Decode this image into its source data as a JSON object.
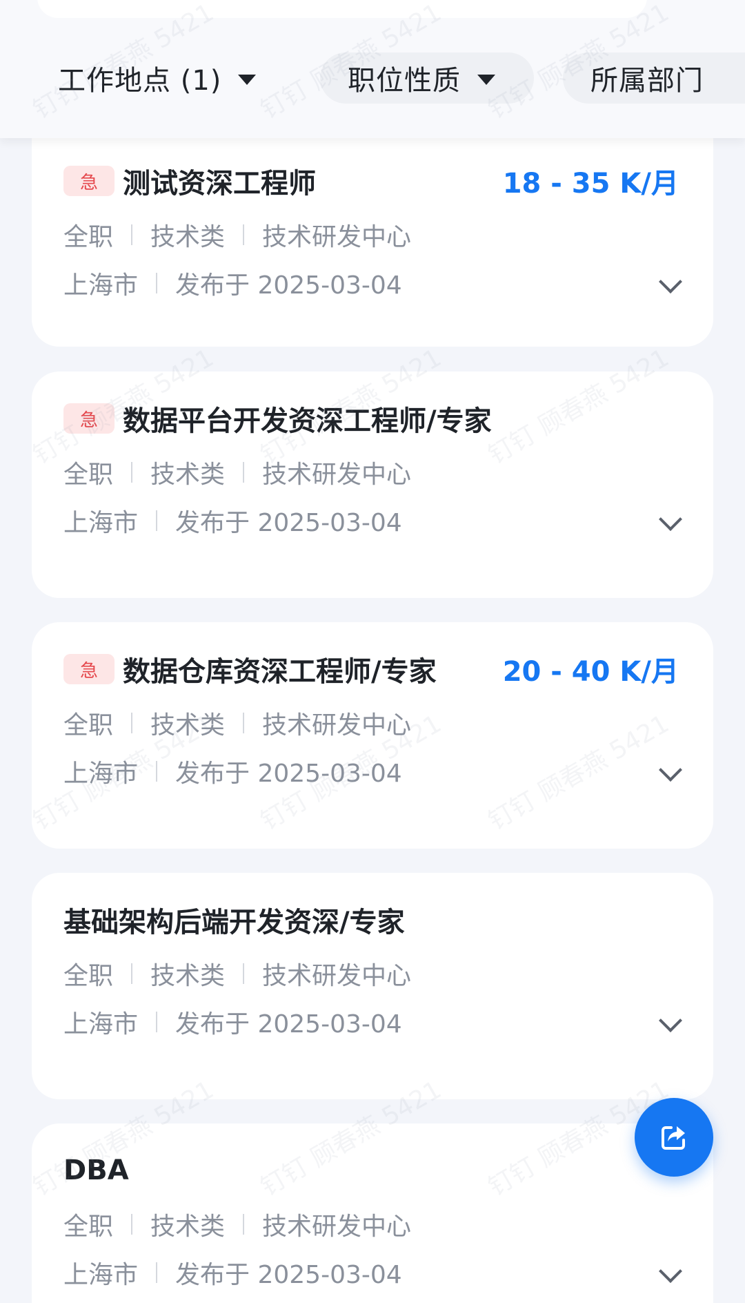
{
  "filters": [
    {
      "label": "工作地点 (1)"
    },
    {
      "label": "职位性质"
    },
    {
      "label": "所属部门"
    }
  ],
  "jobs": [
    {
      "urgent": "急",
      "title": "测试资深工程师",
      "salary": "18 - 35 K/月",
      "type": "全职",
      "category": "技术类",
      "department": "技术研发中心",
      "city": "上海市",
      "published": "发布于 2025-03-04"
    },
    {
      "urgent": "急",
      "title": "数据平台开发资深工程师/专家",
      "salary": "",
      "type": "全职",
      "category": "技术类",
      "department": "技术研发中心",
      "city": "上海市",
      "published": "发布于 2025-03-04"
    },
    {
      "urgent": "急",
      "title": "数据仓库资深工程师/专家",
      "salary": "20 - 40 K/月",
      "type": "全职",
      "category": "技术类",
      "department": "技术研发中心",
      "city": "上海市",
      "published": "发布于 2025-03-04"
    },
    {
      "urgent": "",
      "title": "基础架构后端开发资深/专家",
      "salary": "",
      "type": "全职",
      "category": "技术类",
      "department": "技术研发中心",
      "city": "上海市",
      "published": "发布于 2025-03-04"
    },
    {
      "urgent": "",
      "title": "DBA",
      "salary": "",
      "type": "全职",
      "category": "技术类",
      "department": "技术研发中心",
      "city": "上海市",
      "published": "发布于 2025-03-04"
    }
  ],
  "fab": {
    "icon": "share-icon"
  },
  "watermark": "钉钉 顾春燕 5421",
  "colors": {
    "accent": "#1677f2",
    "urgent_text": "#e5484d",
    "urgent_bg": "#fde6e6",
    "background": "#f3f5fa"
  }
}
